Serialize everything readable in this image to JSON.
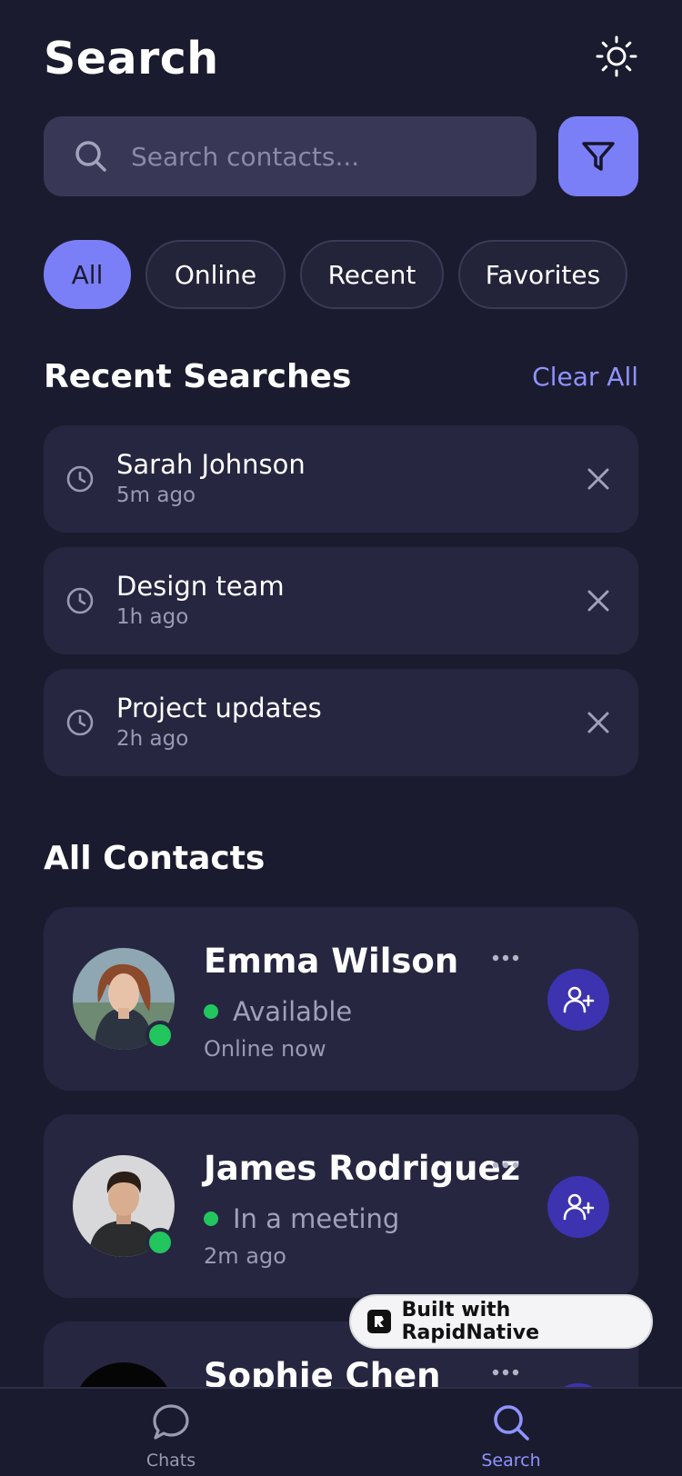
{
  "header": {
    "title": "Search",
    "theme_icon": "sun-icon"
  },
  "search": {
    "placeholder": "Search contacts...",
    "value": ""
  },
  "filters": [
    "All",
    "Online",
    "Recent",
    "Favorites"
  ],
  "recent": {
    "title": "Recent Searches",
    "clear_label": "Clear All",
    "items": [
      {
        "label": "Sarah Johnson",
        "time": "5m ago"
      },
      {
        "label": "Design team",
        "time": "1h ago"
      },
      {
        "label": "Project updates",
        "time": "2h ago"
      }
    ]
  },
  "contacts": {
    "title": "All Contacts",
    "items": [
      {
        "name": "Emma Wilson",
        "status": "Available",
        "time": "Online now"
      },
      {
        "name": "James Rodriguez",
        "status": "In a meeting",
        "time": "2m ago"
      },
      {
        "name": "Sophie Chen"
      }
    ]
  },
  "badge": {
    "label": "Built with RapidNative"
  },
  "nav": {
    "items": [
      {
        "label": "Chats",
        "icon": "chat-bubble-icon"
      },
      {
        "label": "Search",
        "icon": "search-icon"
      }
    ]
  },
  "colors": {
    "background": "#1b1b2f",
    "card": "#262640",
    "accent": "#7b7ff7",
    "online": "#22c55e",
    "add_button": "#3d33b0"
  }
}
